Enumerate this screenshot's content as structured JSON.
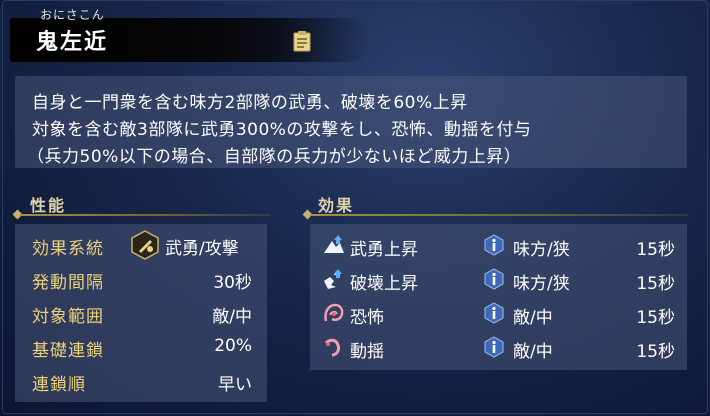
{
  "header": {
    "furigana": "おにさこん",
    "name": "鬼左近",
    "doc_icon": "document-icon"
  },
  "description": {
    "lines": [
      "自身と一門衆を含む味方2部隊の武勇、破壊を60%上昇",
      "対象を含む敵3部隊に武勇300%の攻撃をし、恐怖、動揺を付与",
      "（兵力50%以下の場合、自部隊の兵力が少ないほど威力上昇）"
    ]
  },
  "performance": {
    "title": "性能",
    "rows": [
      {
        "label": "効果系統",
        "value": "武勇/攻撃",
        "icon": "valor-attack-icon"
      },
      {
        "label": "発動間隔",
        "value": "30秒"
      },
      {
        "label": "対象範囲",
        "value": "敵/中"
      },
      {
        "label": "基礎連鎖",
        "value": "20%"
      },
      {
        "label": "連鎖順",
        "value": "早い"
      }
    ]
  },
  "effects": {
    "title": "効果",
    "rows": [
      {
        "name": "武勇上昇",
        "icon": "valor-up-icon",
        "target": "味方/狭",
        "duration": "15秒"
      },
      {
        "name": "破壊上昇",
        "icon": "destruction-up-icon",
        "target": "味方/狭",
        "duration": "15秒"
      },
      {
        "name": "恐怖",
        "icon": "fear-icon",
        "target": "敵/中",
        "duration": "15秒"
      },
      {
        "name": "動揺",
        "icon": "agitation-icon",
        "target": "敵/中",
        "duration": "15秒"
      }
    ]
  },
  "colors": {
    "label_gold": "#ebd27a",
    "section_gold": "#ddd4a8",
    "panel_bg": "#485678",
    "background": "#17264a"
  }
}
